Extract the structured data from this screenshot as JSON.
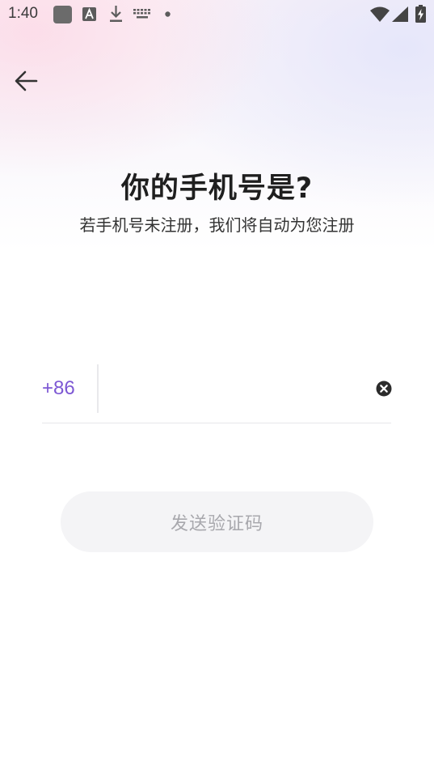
{
  "status_bar": {
    "time": "1:40",
    "icons": [
      "app-square-icon",
      "translate-a-icon",
      "download-icon",
      "keyboard-icon",
      "dot-icon",
      "wifi-icon",
      "signal-icon",
      "battery-charging-icon"
    ]
  },
  "header": {
    "back_icon": "arrow-left-icon"
  },
  "main": {
    "title": "你的手机号是?",
    "subtitle": "若手机号未注册，我们将自动为您注册",
    "country_code": "+86",
    "phone_value": "",
    "clear_icon": "clear-circle-icon",
    "send_code_label": "发送验证码"
  },
  "colors": {
    "accent": "#7d58d4",
    "button_bg": "#f4f4f6",
    "button_text": "#a8a8ad",
    "title": "#1f1f1f"
  }
}
